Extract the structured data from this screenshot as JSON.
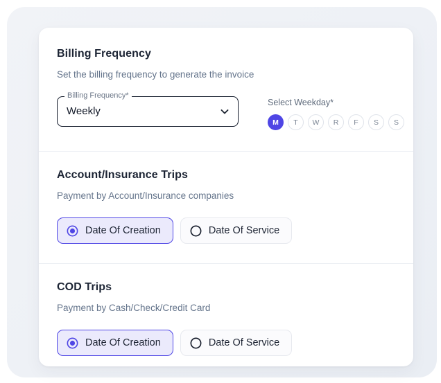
{
  "card": {
    "sections": [
      {
        "id": "billing-frequency",
        "title": "Billing Frequency",
        "subtitle": "Set the billing frequency to generate the invoice",
        "select": {
          "legend": "Billing Frequency*",
          "value": "Weekly",
          "chevron_icon": "chevron-down-icon"
        },
        "weekday": {
          "label": "Select Weekday*",
          "days": [
            {
              "letter": "M",
              "selected": true
            },
            {
              "letter": "T",
              "selected": false
            },
            {
              "letter": "W",
              "selected": false
            },
            {
              "letter": "R",
              "selected": false
            },
            {
              "letter": "F",
              "selected": false
            },
            {
              "letter": "S",
              "selected": false
            },
            {
              "letter": "S",
              "selected": false
            }
          ]
        }
      },
      {
        "id": "account-insurance-trips",
        "title": "Account/Insurance Trips",
        "subtitle": "Payment by Account/Insurance companies",
        "options": [
          {
            "label": "Date Of Creation",
            "selected": true
          },
          {
            "label": "Date Of Service",
            "selected": false
          }
        ]
      },
      {
        "id": "cod-trips",
        "title": "COD Trips",
        "subtitle": "Payment by Cash/Check/Credit Card",
        "options": [
          {
            "label": "Date Of Creation",
            "selected": true
          },
          {
            "label": "Date Of Service",
            "selected": false
          }
        ]
      }
    ]
  },
  "colors": {
    "accent": "#4f46e5",
    "accent_soft": "#ebeafc",
    "page_background": "#eef1f6",
    "card_background": "#ffffff",
    "heading_text": "#1c2434",
    "muted_text": "#64748b",
    "divider": "#eceff4"
  }
}
